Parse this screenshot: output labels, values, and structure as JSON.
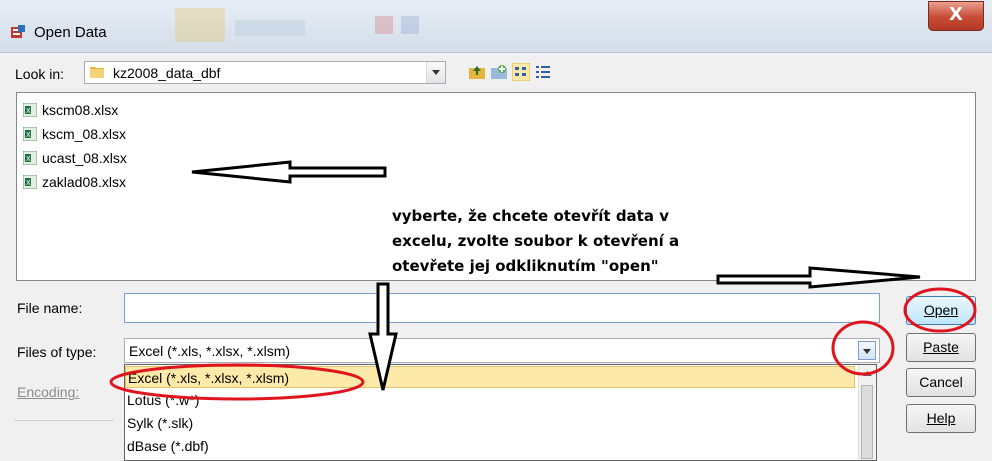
{
  "window": {
    "title": "Open Data",
    "close_glyph": "X"
  },
  "look_in": {
    "label": "Look in:",
    "value": "kz2008_data_dbf",
    "toolbar_icons": [
      "up-folder-icon",
      "new-folder-icon",
      "list-view-icon",
      "details-view-icon"
    ]
  },
  "files": [
    {
      "name": "kscm08.xlsx"
    },
    {
      "name": "kscm_08.xlsx"
    },
    {
      "name": "ucast_08.xlsx"
    },
    {
      "name": "zaklad08.xlsx"
    }
  ],
  "file_name": {
    "label": "File name:",
    "value": ""
  },
  "file_type": {
    "label": "Files of type:",
    "value": "Excel (*.xls, *.xlsx, *.xlsm)",
    "options": [
      "Excel (*.xls, *.xlsx, *.xlsm)",
      "Lotus (*.w*)",
      "Sylk (*.slk)",
      "dBase (*.dbf)"
    ],
    "selected_index": 0
  },
  "encoding": {
    "label": "Encoding:"
  },
  "buttons": {
    "open": "Open",
    "paste": "Paste",
    "cancel": "Cancel",
    "help": "Help"
  },
  "annotation": {
    "lines": [
      "vyberte, že chcete otevřít data v",
      "excelu, zvolte soubor k otevření a",
      "otevřete jej odkliknutím \"open\""
    ],
    "ink_color": "#e0141e"
  },
  "colors": {
    "selected_option_bg": "#fde9a8",
    "title_bar": "#d3dde9",
    "dialog_bg": "#f0f0f0"
  }
}
